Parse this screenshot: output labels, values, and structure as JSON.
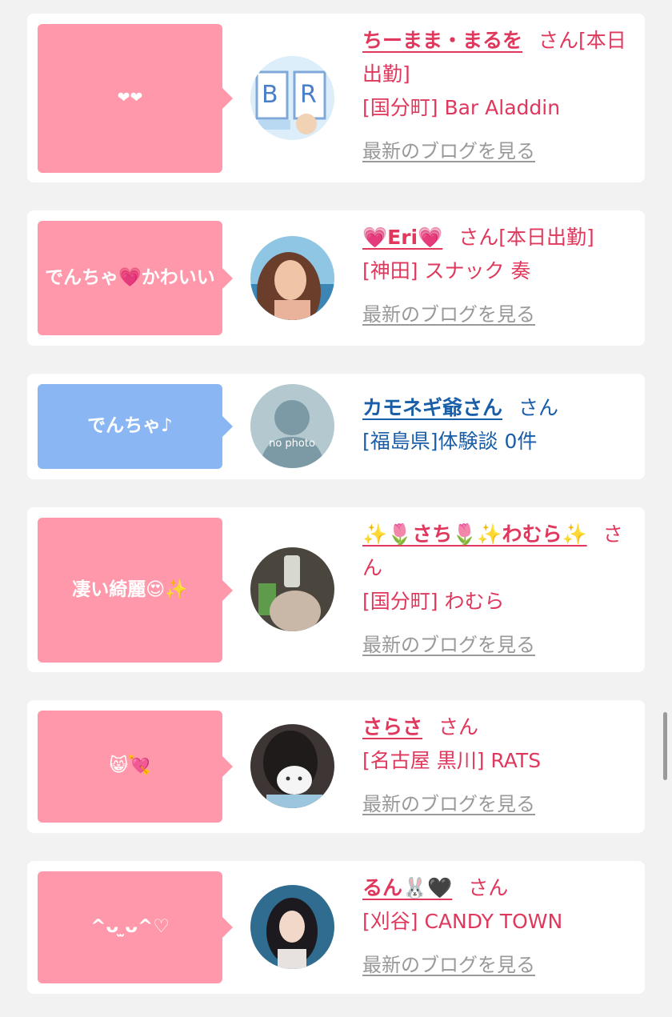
{
  "colors": {
    "bubble_pink": "#fe98aa",
    "bubble_blue": "#8ab6f4",
    "name_pink": "#e0385d",
    "name_blue": "#1a5ea8",
    "link_gray": "#999999"
  },
  "entries": [
    {
      "comment": "❤❤",
      "name": "ちーまま・まるを",
      "honorific": "さん",
      "status": "[本日出勤]",
      "location": "[国分町] Bar Aladdin",
      "blog_link": "最新のブログを見る",
      "avatar": "birthday-event-photo"
    },
    {
      "comment": "でんちゃ💗かわいい",
      "name": "💗Eri💗",
      "honorific": "さん",
      "status": "[本日出勤]",
      "location": "[神田] スナック 奏",
      "blog_link": "最新のブログを見る",
      "avatar": "woman-beach-photo"
    },
    {
      "comment": "でんちゃ♪",
      "name": "カモネギ爺さん",
      "honorific": "さん",
      "location": "[福島県]体験談 0件",
      "avatar": "no-photo-silhouette",
      "avatar_text": "no photo"
    },
    {
      "comment": "凄い綺麗😍✨",
      "name": "✨🌷さち🌷✨わむら✨",
      "honorific": "さん",
      "location": "[国分町] わむら",
      "blog_link": "最新のブログを見る",
      "avatar": "woman-with-drink-photo"
    },
    {
      "comment": "😸💘",
      "name": "さらさ",
      "honorific": "さん",
      "location": "[名古屋 黒川] RATS",
      "blog_link": "最新のブログを見る",
      "avatar": "woman-with-mask-photo"
    },
    {
      "comment": "^ᴗ ̫ᴗ^♡",
      "name": "るん🐰🖤",
      "honorific": "さん",
      "location": "[刈谷] CANDY TOWN",
      "blog_link": "最新のブログを見る",
      "avatar": "woman-portrait-photo"
    }
  ]
}
